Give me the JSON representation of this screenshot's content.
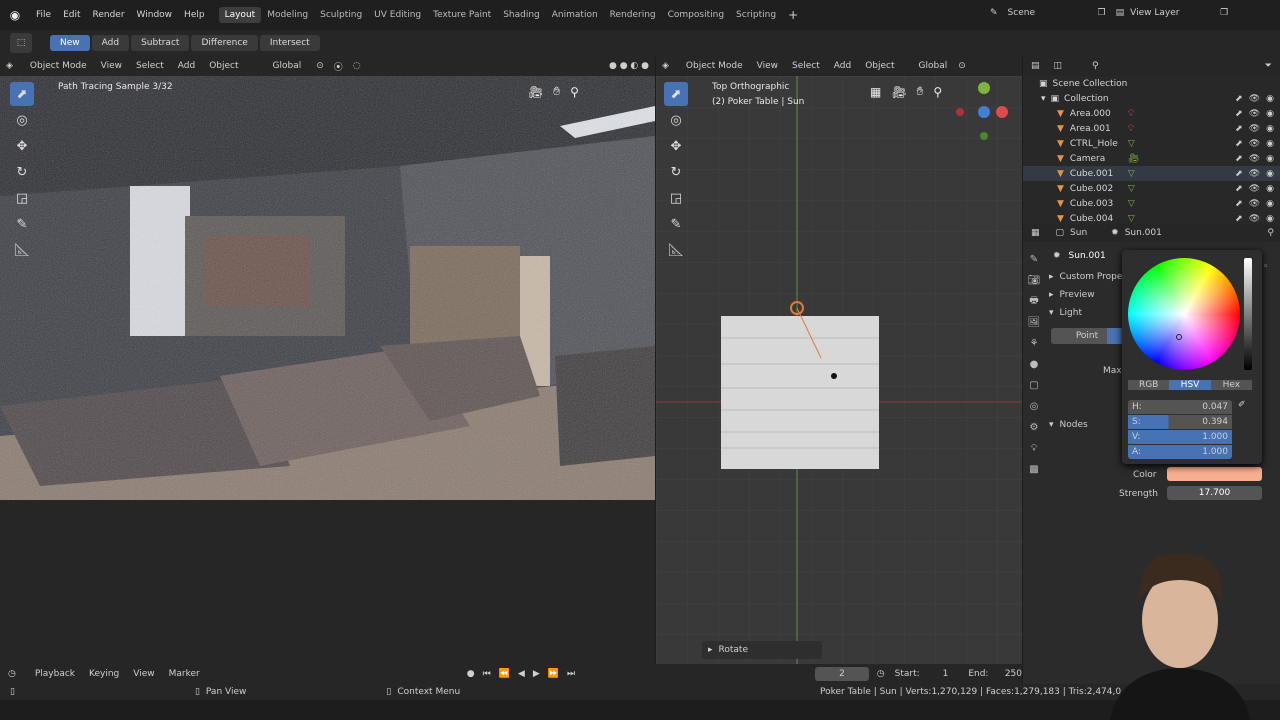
{
  "menu": {
    "file": "File",
    "edit": "Edit",
    "render": "Render",
    "window": "Window",
    "help": "Help"
  },
  "workspaces": [
    "Layout",
    "Modeling",
    "Sculpting",
    "UV Editing",
    "Texture Paint",
    "Shading",
    "Animation",
    "Rendering",
    "Compositing",
    "Scripting"
  ],
  "scene": {
    "label": "Scene",
    "view_layer": "View Layer"
  },
  "toolbar": {
    "new": "New",
    "add": "Add",
    "subtract": "Subtract",
    "difference": "Difference",
    "intersect": "Intersect"
  },
  "left_vp": {
    "mode": "Object Mode",
    "view": "View",
    "select": "Select",
    "add": "Add",
    "object": "Object",
    "orient": "Global",
    "status": "Path Tracing Sample 3/32"
  },
  "right_vp": {
    "mode": "Object Mode",
    "view": "View",
    "select": "Select",
    "add": "Add",
    "object": "Object",
    "orient": "Global",
    "title": "Top Orthographic",
    "subtitle": "(2) Poker Table | Sun",
    "rotate": "Rotate"
  },
  "outliner": {
    "scene_collection": "Scene Collection",
    "collection": "Collection",
    "items": [
      {
        "label": "Area.000",
        "icon": "light"
      },
      {
        "label": "Area.001",
        "icon": "light"
      },
      {
        "label": "CTRL_Hole",
        "icon": "mesh"
      },
      {
        "label": "Camera",
        "icon": "camera"
      },
      {
        "label": "Cube.001",
        "icon": "mesh"
      },
      {
        "label": "Cube.002",
        "icon": "mesh"
      },
      {
        "label": "Cube.003",
        "icon": "mesh"
      },
      {
        "label": "Cube.004",
        "icon": "mesh"
      }
    ]
  },
  "props": {
    "breadcrumb_object": "Sun",
    "breadcrumb_data": "Sun.001",
    "data_name": "Sun.001",
    "custom_props": "Custom Prope",
    "preview": "Preview",
    "light": "Light",
    "point": "Point",
    "max": "Max",
    "nodes": "Nodes",
    "color_label": "Color",
    "strength_label": "Strength",
    "strength_value": "17.700",
    "color_swatch": "#f7b08f"
  },
  "color_picker": {
    "modes": [
      "RGB",
      "HSV",
      "Hex"
    ],
    "active_mode": "HSV",
    "h_label": "H:",
    "h_value": "0.047",
    "s_label": "S:",
    "s_value": "0.394",
    "v_label": "V:",
    "v_value": "1.000",
    "a_label": "A:",
    "a_value": "1.000"
  },
  "timeline": {
    "playback": "Playback",
    "keying": "Keying",
    "view": "View",
    "marker": "Marker",
    "frame": "2",
    "start_label": "Start:",
    "start": "1",
    "end_label": "End:",
    "end": "250"
  },
  "statusbar": {
    "pan": "Pan View",
    "context": "Context Menu",
    "stats": "Poker Table | Sun | Verts:1,270,129 | Faces:1,279,183 | Tris:2,474,0"
  },
  "colors": {
    "accent": "#4772b3",
    "header": "#262626",
    "panel": "#303030",
    "viewport_grid": "#3a3a3a"
  }
}
